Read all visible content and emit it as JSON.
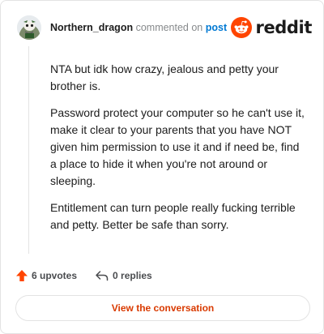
{
  "header": {
    "username": "Northern_dragon",
    "commented_text": "commented on",
    "post_link": "post"
  },
  "brand": {
    "wordmark": "reddit",
    "color": "#ff4500"
  },
  "comment": {
    "paragraphs": [
      "NTA but idk how crazy, jealous and petty your brother is.",
      "Password protect your computer so he can't use it, make it clear to your parents that you have NOT given him permission to use it and if need be, find a place to hide it when you're not around or sleeping.",
      "Entitlement can turn people really fucking terrible and petty. Better be safe than sorry."
    ]
  },
  "actions": {
    "upvotes_label": "6 upvotes",
    "replies_label": "0 replies"
  },
  "footer": {
    "view_conversation_label": "View the conversation"
  },
  "icons": {
    "avatar": "avatar-icon",
    "brand": "reddit-logo-icon",
    "upvote": "upvote-arrow-icon",
    "reply": "reply-arrow-icon"
  },
  "colors": {
    "upvote": "#ff4500",
    "link": "#0079d3",
    "cta": "#d93a00"
  }
}
